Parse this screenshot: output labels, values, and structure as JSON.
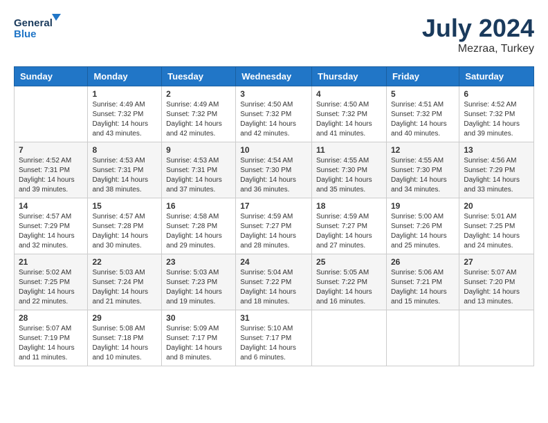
{
  "header": {
    "logo_line1": "General",
    "logo_line2": "Blue",
    "month": "July 2024",
    "location": "Mezraa, Turkey"
  },
  "weekdays": [
    "Sunday",
    "Monday",
    "Tuesday",
    "Wednesday",
    "Thursday",
    "Friday",
    "Saturday"
  ],
  "weeks": [
    [
      {
        "day": "",
        "info": ""
      },
      {
        "day": "1",
        "info": "Sunrise: 4:49 AM\nSunset: 7:32 PM\nDaylight: 14 hours\nand 43 minutes."
      },
      {
        "day": "2",
        "info": "Sunrise: 4:49 AM\nSunset: 7:32 PM\nDaylight: 14 hours\nand 42 minutes."
      },
      {
        "day": "3",
        "info": "Sunrise: 4:50 AM\nSunset: 7:32 PM\nDaylight: 14 hours\nand 42 minutes."
      },
      {
        "day": "4",
        "info": "Sunrise: 4:50 AM\nSunset: 7:32 PM\nDaylight: 14 hours\nand 41 minutes."
      },
      {
        "day": "5",
        "info": "Sunrise: 4:51 AM\nSunset: 7:32 PM\nDaylight: 14 hours\nand 40 minutes."
      },
      {
        "day": "6",
        "info": "Sunrise: 4:52 AM\nSunset: 7:32 PM\nDaylight: 14 hours\nand 39 minutes."
      }
    ],
    [
      {
        "day": "7",
        "info": "Sunrise: 4:52 AM\nSunset: 7:31 PM\nDaylight: 14 hours\nand 39 minutes."
      },
      {
        "day": "8",
        "info": "Sunrise: 4:53 AM\nSunset: 7:31 PM\nDaylight: 14 hours\nand 38 minutes."
      },
      {
        "day": "9",
        "info": "Sunrise: 4:53 AM\nSunset: 7:31 PM\nDaylight: 14 hours\nand 37 minutes."
      },
      {
        "day": "10",
        "info": "Sunrise: 4:54 AM\nSunset: 7:30 PM\nDaylight: 14 hours\nand 36 minutes."
      },
      {
        "day": "11",
        "info": "Sunrise: 4:55 AM\nSunset: 7:30 PM\nDaylight: 14 hours\nand 35 minutes."
      },
      {
        "day": "12",
        "info": "Sunrise: 4:55 AM\nSunset: 7:30 PM\nDaylight: 14 hours\nand 34 minutes."
      },
      {
        "day": "13",
        "info": "Sunrise: 4:56 AM\nSunset: 7:29 PM\nDaylight: 14 hours\nand 33 minutes."
      }
    ],
    [
      {
        "day": "14",
        "info": "Sunrise: 4:57 AM\nSunset: 7:29 PM\nDaylight: 14 hours\nand 32 minutes."
      },
      {
        "day": "15",
        "info": "Sunrise: 4:57 AM\nSunset: 7:28 PM\nDaylight: 14 hours\nand 30 minutes."
      },
      {
        "day": "16",
        "info": "Sunrise: 4:58 AM\nSunset: 7:28 PM\nDaylight: 14 hours\nand 29 minutes."
      },
      {
        "day": "17",
        "info": "Sunrise: 4:59 AM\nSunset: 7:27 PM\nDaylight: 14 hours\nand 28 minutes."
      },
      {
        "day": "18",
        "info": "Sunrise: 4:59 AM\nSunset: 7:27 PM\nDaylight: 14 hours\nand 27 minutes."
      },
      {
        "day": "19",
        "info": "Sunrise: 5:00 AM\nSunset: 7:26 PM\nDaylight: 14 hours\nand 25 minutes."
      },
      {
        "day": "20",
        "info": "Sunrise: 5:01 AM\nSunset: 7:25 PM\nDaylight: 14 hours\nand 24 minutes."
      }
    ],
    [
      {
        "day": "21",
        "info": "Sunrise: 5:02 AM\nSunset: 7:25 PM\nDaylight: 14 hours\nand 22 minutes."
      },
      {
        "day": "22",
        "info": "Sunrise: 5:03 AM\nSunset: 7:24 PM\nDaylight: 14 hours\nand 21 minutes."
      },
      {
        "day": "23",
        "info": "Sunrise: 5:03 AM\nSunset: 7:23 PM\nDaylight: 14 hours\nand 19 minutes."
      },
      {
        "day": "24",
        "info": "Sunrise: 5:04 AM\nSunset: 7:22 PM\nDaylight: 14 hours\nand 18 minutes."
      },
      {
        "day": "25",
        "info": "Sunrise: 5:05 AM\nSunset: 7:22 PM\nDaylight: 14 hours\nand 16 minutes."
      },
      {
        "day": "26",
        "info": "Sunrise: 5:06 AM\nSunset: 7:21 PM\nDaylight: 14 hours\nand 15 minutes."
      },
      {
        "day": "27",
        "info": "Sunrise: 5:07 AM\nSunset: 7:20 PM\nDaylight: 14 hours\nand 13 minutes."
      }
    ],
    [
      {
        "day": "28",
        "info": "Sunrise: 5:07 AM\nSunset: 7:19 PM\nDaylight: 14 hours\nand 11 minutes."
      },
      {
        "day": "29",
        "info": "Sunrise: 5:08 AM\nSunset: 7:18 PM\nDaylight: 14 hours\nand 10 minutes."
      },
      {
        "day": "30",
        "info": "Sunrise: 5:09 AM\nSunset: 7:17 PM\nDaylight: 14 hours\nand 8 minutes."
      },
      {
        "day": "31",
        "info": "Sunrise: 5:10 AM\nSunset: 7:17 PM\nDaylight: 14 hours\nand 6 minutes."
      },
      {
        "day": "",
        "info": ""
      },
      {
        "day": "",
        "info": ""
      },
      {
        "day": "",
        "info": ""
      }
    ]
  ]
}
